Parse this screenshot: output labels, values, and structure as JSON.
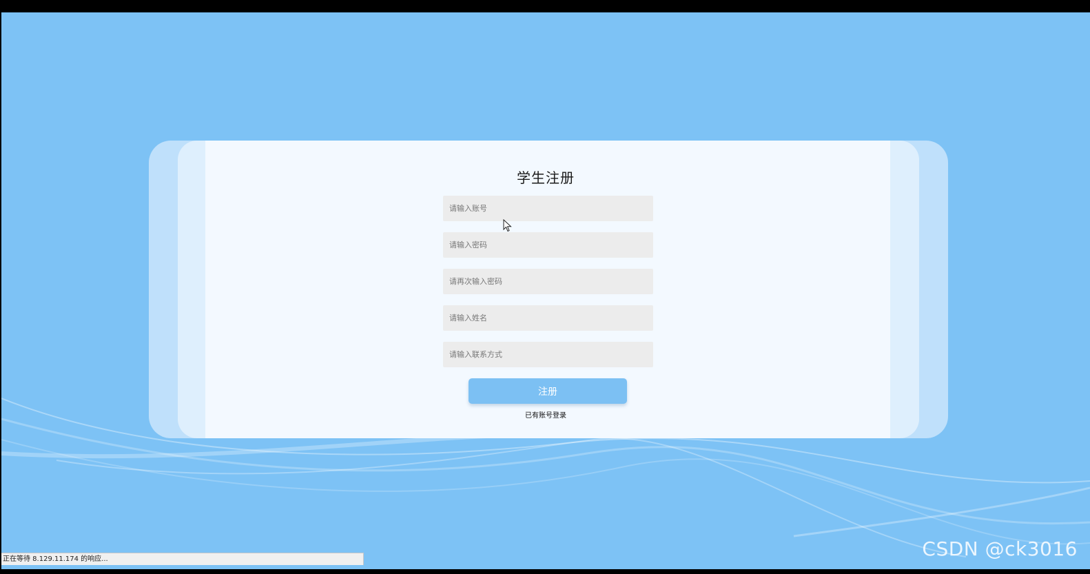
{
  "register": {
    "title": "学生注册",
    "fields": [
      {
        "placeholder": "请输入账号",
        "value": ""
      },
      {
        "placeholder": "请输入密码",
        "value": ""
      },
      {
        "placeholder": "请再次输入密码",
        "value": ""
      },
      {
        "placeholder": "请输入姓名",
        "value": ""
      },
      {
        "placeholder": "请输入联系方式",
        "value": ""
      }
    ],
    "submit_label": "注册",
    "login_link": "已有账号登录"
  },
  "status_bar": {
    "text": "正在等待 8.129.11.174 的响应..."
  },
  "watermark": {
    "text": "CSDN @ck3016"
  },
  "colors": {
    "background": "#7dc2f5",
    "card": "#f3f9ff",
    "button": "#7cc0f3",
    "field": "#ececec"
  },
  "icons": {
    "cursor": "mouse-pointer-icon"
  }
}
